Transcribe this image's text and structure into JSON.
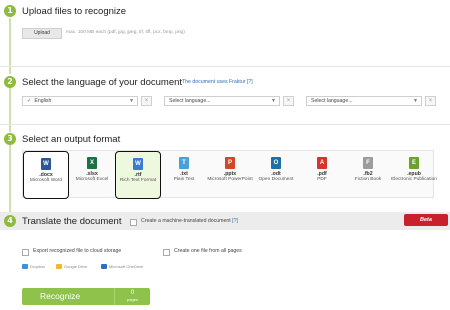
{
  "steps": [
    {
      "num": "1",
      "title": "Upload files to recognize"
    },
    {
      "num": "2",
      "title": "Select the language of your document"
    },
    {
      "num": "3",
      "title": "Select an output format"
    },
    {
      "num": "4",
      "title": "Translate the document"
    }
  ],
  "upload": {
    "button": "Upload",
    "hint": "max. 100 MB each (pdf, jpg, jpeg, tif, tiff, pcx, bmp, png)"
  },
  "language": {
    "fraktur_link": "The document uses Fraktur [?]",
    "selects": [
      "English",
      "Select language...",
      "Select language..."
    ],
    "remove": "×",
    "selected_check": "✓"
  },
  "formats": [
    {
      "ext": ".docx",
      "name": "Microsoft Word",
      "color": "#2b5797",
      "letter": "W"
    },
    {
      "ext": ".xlsx",
      "name": "Microsoft Excel",
      "color": "#1e7145",
      "letter": "X"
    },
    {
      "ext": ".rtf",
      "name": "Rich Text Format",
      "color": "#3a7bd5",
      "letter": "W"
    },
    {
      "ext": ".txt",
      "name": "Plain Text",
      "color": "#4aa0d8",
      "letter": "T"
    },
    {
      "ext": ".pptx",
      "name": "Microsoft PowerPoint",
      "color": "#d24726",
      "letter": "P"
    },
    {
      "ext": ".odt",
      "name": "Open Document",
      "color": "#1f6fa8",
      "letter": "O"
    },
    {
      "ext": ".pdf",
      "name": "PDF",
      "color": "#d9342b",
      "letter": "A"
    },
    {
      "ext": ".fb2",
      "name": "Fiction Book",
      "color": "#9c9c9c",
      "letter": "F"
    },
    {
      "ext": ".epub",
      "name": "Electronic Publication",
      "color": "#6aa22d",
      "letter": "E"
    }
  ],
  "translate": {
    "checkbox_label": "Create a machine-translated document",
    "help": "[?]",
    "beta": "Beta"
  },
  "options": {
    "export_label": "Export recognized file to cloud storage",
    "onefile_label": "Create one file from all pages"
  },
  "clouds": [
    {
      "name": "Dropbox",
      "color": "#3d8fe0"
    },
    {
      "name": "Google Drive",
      "color": "#f2b92e"
    },
    {
      "name": "Microsoft OneDrive",
      "color": "#2f6fc3"
    }
  ],
  "recognize": {
    "label": "Recognize",
    "count": "0",
    "pages": "pages"
  },
  "colors": {
    "accent": "#8dbb3e",
    "beta": "#c8202c",
    "link": "#2c6fb3"
  }
}
